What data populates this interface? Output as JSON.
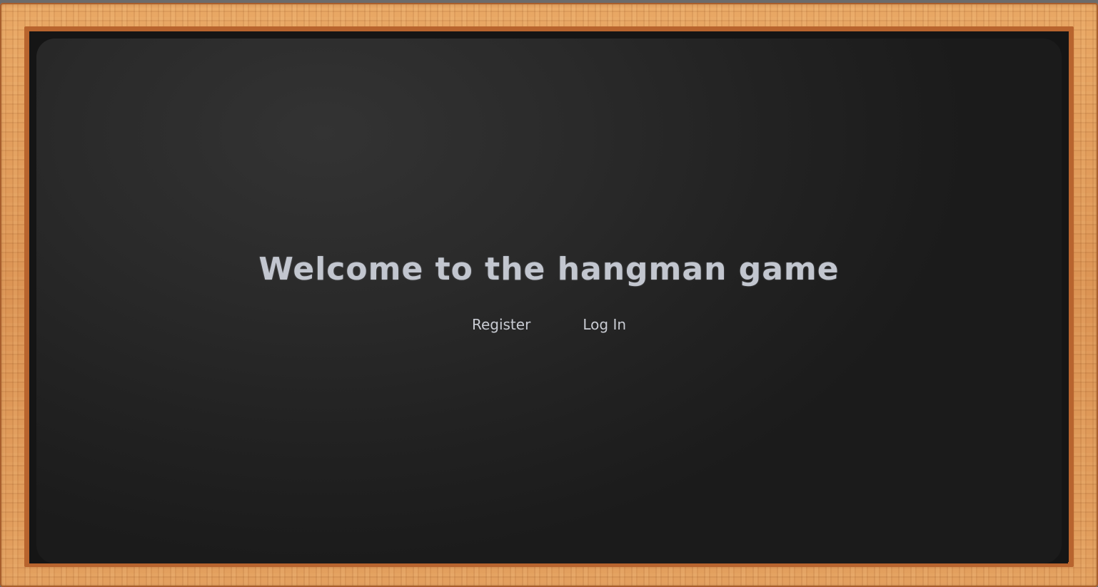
{
  "page": {
    "title": "Welcome to the hangman game"
  },
  "nav": {
    "register_label": "Register",
    "login_label": "Log In"
  },
  "colors": {
    "frame_wood": "#e3a05f",
    "frame_edge": "#b8642e",
    "board": "#222222",
    "text": "#c2c6cf"
  }
}
